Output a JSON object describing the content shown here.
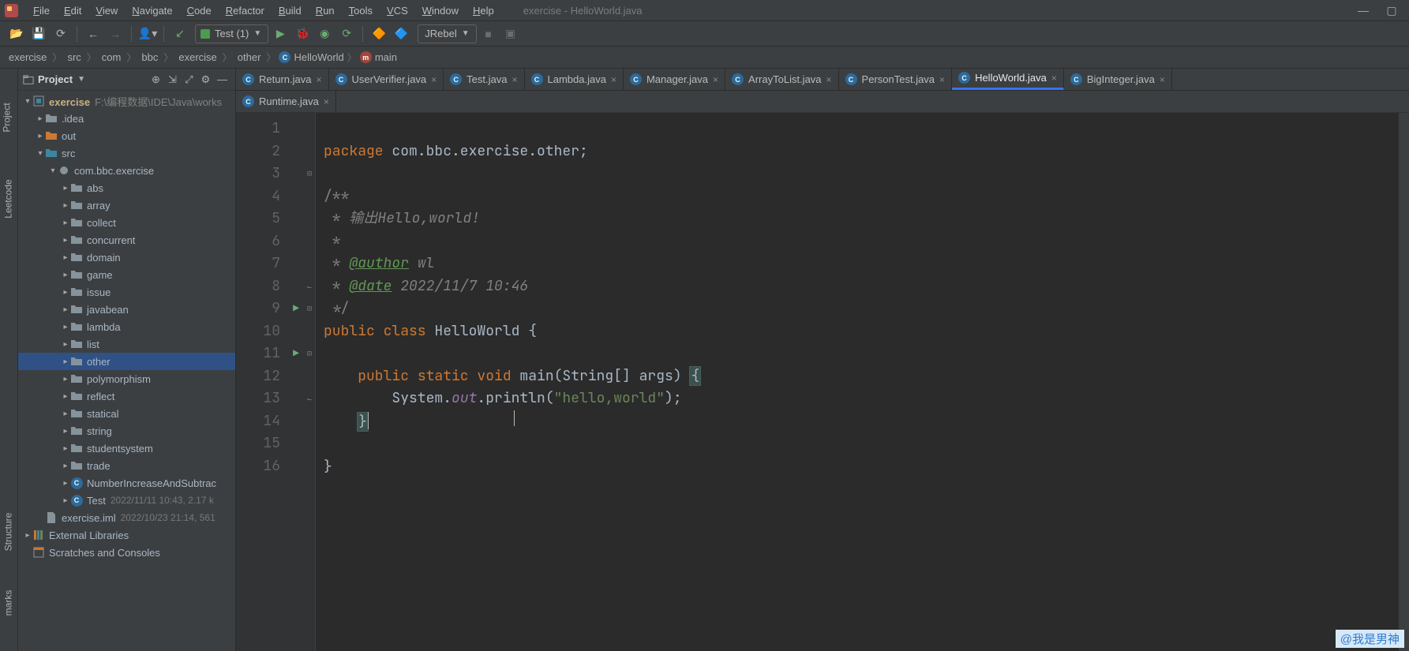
{
  "window_title": "exercise - HelloWorld.java",
  "menu": [
    "File",
    "Edit",
    "View",
    "Navigate",
    "Code",
    "Refactor",
    "Build",
    "Run",
    "Tools",
    "VCS",
    "Window",
    "Help"
  ],
  "toolbar": {
    "run_config": "Test (1)",
    "jrebel": "JRebel"
  },
  "breadcrumbs": [
    "exercise",
    "src",
    "com",
    "bbc",
    "exercise",
    "other"
  ],
  "breadcrumb_class": "HelloWorld",
  "breadcrumb_method": "main",
  "project_panel_title": "Project",
  "tree": {
    "root": "exercise",
    "root_path": "F:\\编程数据\\IDE\\Java\\works",
    "idea": ".idea",
    "out": "out",
    "src": "src",
    "pkg": "com.bbc.exercise",
    "folders": [
      "abs",
      "array",
      "collect",
      "concurrent",
      "domain",
      "game",
      "issue",
      "javabean",
      "lambda",
      "list",
      "other",
      "polymorphism",
      "reflect",
      "statical",
      "string",
      "studentsystem",
      "trade"
    ],
    "class1": "NumberIncreaseAndSubtrac",
    "class2": "Test",
    "class2_meta": "2022/11/11 10:43, 2.17 k",
    "iml": "exercise.iml",
    "iml_meta": "2022/10/23 21:14, 561",
    "ext_lib": "External Libraries",
    "scratch": "Scratches and Consoles"
  },
  "tabs_row1": [
    {
      "label": "Return.java",
      "active": false
    },
    {
      "label": "UserVerifier.java",
      "active": false
    },
    {
      "label": "Test.java",
      "active": false
    },
    {
      "label": "Lambda.java",
      "active": false
    },
    {
      "label": "Manager.java",
      "active": false
    },
    {
      "label": "ArrayToList.java",
      "active": false
    },
    {
      "label": "PersonTest.java",
      "active": false
    },
    {
      "label": "HelloWorld.java",
      "active": true
    },
    {
      "label": "BigInteger.java",
      "active": false
    }
  ],
  "tabs_row2": [
    {
      "label": "Runtime.java",
      "active": false
    }
  ],
  "code": {
    "pkg_kw": "package",
    "pkg_name": " com.bbc.exercise.other",
    "c_open": "/**",
    "c_line1_a": " * ",
    "c_line1_b": "输出Hello,world!",
    "c_star": " *",
    "c_auth_a": " * ",
    "c_auth_tag": "@author",
    "c_auth_b": " wl",
    "c_date_a": " * ",
    "c_date_tag": "@date",
    "c_date_b": " 2022/11/7 10:46",
    "c_close": " */",
    "cls_pub": "public ",
    "cls_kw": "class ",
    "cls_name": "HelloWorld ",
    "m_pub": "public ",
    "m_stat": "static ",
    "m_void": "void ",
    "m_name": "main",
    "m_args": "(String[] args) ",
    "sys": "System.",
    "out": "out",
    "println": ".println(",
    "hello": "\"hello,world\"",
    "end": ");"
  },
  "line_numbers": [
    1,
    2,
    3,
    4,
    5,
    6,
    7,
    8,
    9,
    10,
    11,
    12,
    13,
    14,
    15,
    16
  ],
  "left_tools": {
    "project": "Project",
    "leetcode": "Leetcode",
    "structure": "Structure",
    "bookmarks": "marks"
  },
  "watermark": "@我是男神"
}
